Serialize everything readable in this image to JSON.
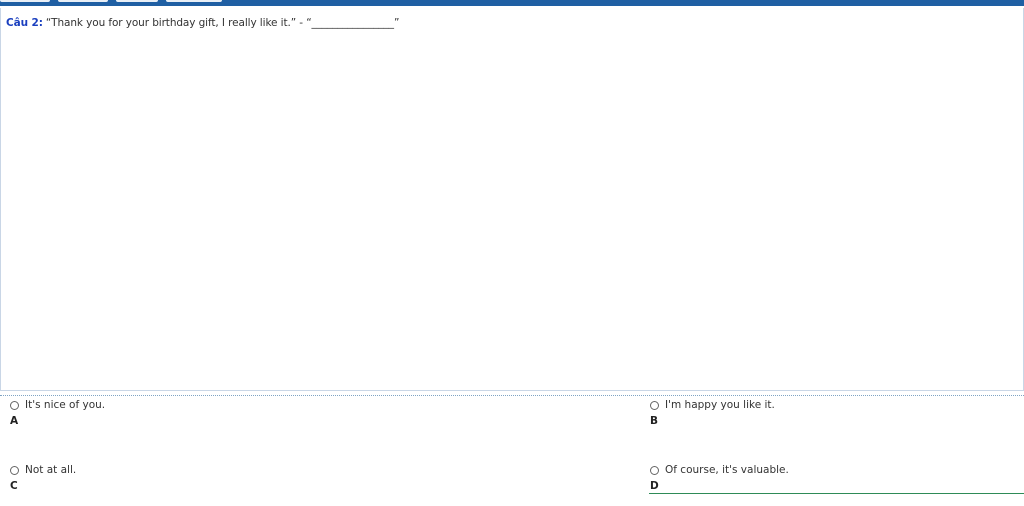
{
  "question": {
    "number_label": "Câu 2:",
    "text": "“Thank you for your birthday gift, I really like it.” - “________________”"
  },
  "options": [
    {
      "letter": "A",
      "text": "It's nice of you."
    },
    {
      "letter": "B",
      "text": "I'm happy you like it."
    },
    {
      "letter": "C",
      "text": "Not at all."
    },
    {
      "letter": "D",
      "text": "Of course, it's valuable."
    }
  ],
  "colors": {
    "topbar": "#1f5fa3",
    "question_number": "#1a3fbf",
    "focus_underline": "#2e8b57"
  },
  "icons": [
    "radio-icon"
  ]
}
